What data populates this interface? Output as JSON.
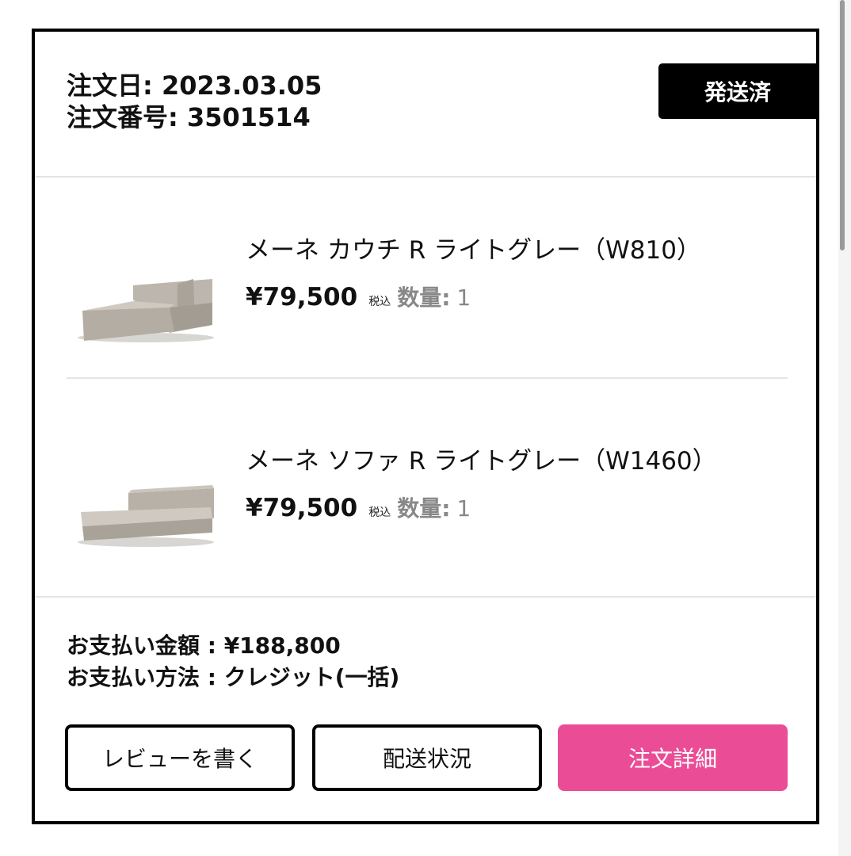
{
  "order": {
    "date_label": "注文日:",
    "date_value": "2023.03.05",
    "number_label": "注文番号:",
    "number_value": "3501514",
    "status": "発送済"
  },
  "items": [
    {
      "name": "メーネ カウチ R ライトグレー（W810）",
      "price": "¥79,500",
      "tax_label": "税込",
      "qty_label": "数量:",
      "qty": "1",
      "thumbnail_icon": "sofa-chaise-icon"
    },
    {
      "name": "メーネ ソファ R ライトグレー（W1460）",
      "price": "¥79,500",
      "tax_label": "税込",
      "qty_label": "数量:",
      "qty": "1",
      "thumbnail_icon": "sofa-icon"
    }
  ],
  "payment": {
    "amount_label": "お支払い金額 :",
    "amount_value": "¥188,800",
    "method_label": "お支払い方法 :",
    "method_value": "クレジット(一括)"
  },
  "buttons": {
    "review": "レビューを書く",
    "shipping": "配送状況",
    "detail": "注文詳細"
  },
  "colors": {
    "accent": "#ea4d96",
    "badge_bg": "#000000",
    "border": "#000000",
    "divider": "#e4e4e4",
    "muted_text": "#888888"
  }
}
